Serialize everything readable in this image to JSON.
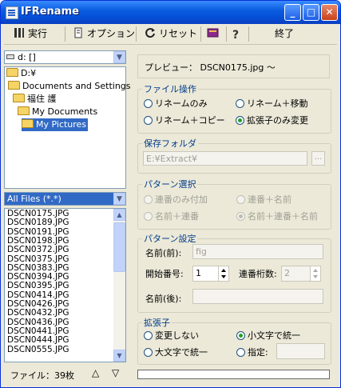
{
  "window": {
    "title": "IFRename"
  },
  "toolbar": {
    "run": "実行",
    "options": "オプション",
    "reset": "リセット",
    "quit": "終了"
  },
  "drive": "d: []",
  "tree": [
    {
      "label": "D:¥",
      "indent": 0,
      "selected": false
    },
    {
      "label": "Documents and Settings",
      "indent": 1,
      "selected": false
    },
    {
      "label": "福住  護",
      "indent": 2,
      "selected": false
    },
    {
      "label": "My Documents",
      "indent": 3,
      "selected": false
    },
    {
      "label": "My Pictures",
      "indent": 4,
      "selected": true
    }
  ],
  "filter": "All Files (*.*)",
  "files": [
    "DSCN0175.JPG",
    "DSCN0189.JPG",
    "DSCN0191.JPG",
    "DSCN0198.JPG",
    "DSCN0372.JPG",
    "DSCN0375.JPG",
    "DSCN0383.JPG",
    "DSCN0394.JPG",
    "DSCN0395.JPG",
    "DSCN0414.JPG",
    "DSCN0426.JPG",
    "DSCN0432.JPG",
    "DSCN0436.JPG",
    "DSCN0441.JPG",
    "DSCN0444.JPG",
    "DSCN0555.JPG"
  ],
  "status": "ファイル：39枚",
  "preview": "プレビュー：  DSCN0175.jpg  〜",
  "file_ops": {
    "legend": "ファイル操作",
    "options": [
      "リネームのみ",
      "リネーム＋移動",
      "リネーム＋コピー",
      "拡張子のみ変更"
    ],
    "selected": "拡張子のみ変更"
  },
  "save_folder": {
    "legend": "保存フォルダ",
    "value": "E:¥Extract¥",
    "browse": "..."
  },
  "pattern": {
    "legend": "パターン選択",
    "options": [
      "連番のみ付加",
      "連番＋名前",
      "名前＋連番",
      "名前＋連番＋名前"
    ],
    "selected": "名前＋連番＋名前"
  },
  "pattern_settings": {
    "legend": "パターン設定",
    "prefix_label": "名前(前):",
    "prefix_value": "fig",
    "start_label": "開始番号:",
    "start_value": "1",
    "digits_label": "連番桁数:",
    "digits_value": "2",
    "suffix_label": "名前(後):",
    "suffix_value": ""
  },
  "extension": {
    "legend": "拡張子",
    "options": [
      "変更しない",
      "小文字で統一",
      "大文字で統一",
      "指定:"
    ],
    "selected": "小文字で統一"
  },
  "progress": 0
}
